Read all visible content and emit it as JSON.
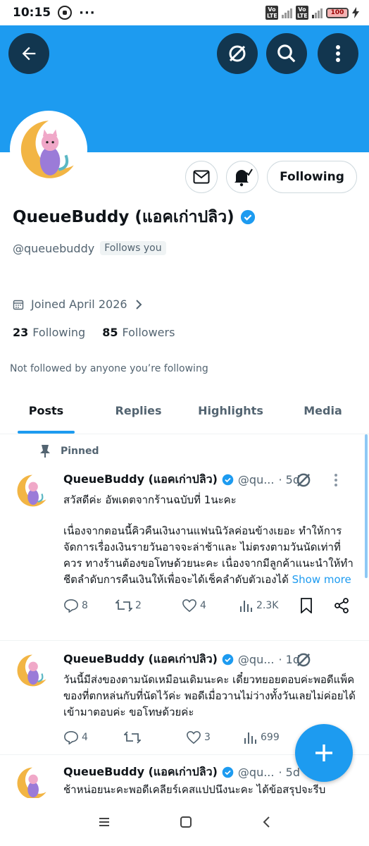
{
  "status_bar": {
    "time": "10:15",
    "more": "···",
    "volte": "Vo LTE",
    "battery": "100"
  },
  "header": {
    "back": "back",
    "grok": "grok",
    "search": "search",
    "more": "more"
  },
  "profile": {
    "name": "QueueBuddy (แอคเก่าปลิว)",
    "handle": "@queuebuddy",
    "follows_you": "Follows you",
    "joined": "Joined April 2026",
    "following_count": "23",
    "following_label": "Following",
    "followers_count": "85",
    "followers_label": "Followers",
    "not_followed": "Not followed by anyone you’re following",
    "following_button": "Following"
  },
  "tabs": [
    "Posts",
    "Replies",
    "Highlights",
    "Media"
  ],
  "pinned_label": "Pinned",
  "tweets": [
    {
      "name": "QueueBuddy (แอคเก่าปลิว)",
      "handle": "@qu...",
      "time": "· 5d",
      "line1": "สวัสดีค่ะ อัพเดตจากร้านฉบับที่ 1นะคะ",
      "line2": "เนื่องจากตอนนี้คิวคืนเงินงานแฟนนิวัลค่อนข้างเยอะ ทำให้การจัดการเรื่องเงินรายวันอาจจะล่าช้าและ ไม่ตรงตามวันนัดเท่าที่ควร ทางร้านต้องขอโทษด้วยนะคะ เนื่องจากมีลูกค้าแนะนำให้ทำชีตลำดับการคืนเงินให้เพื่อจะได้เช็คลำดับตัวเองได้",
      "show_more": "Show more",
      "replies": "8",
      "reposts": "2",
      "likes": "4",
      "views": "2.3K"
    },
    {
      "name": "QueueBuddy (แอคเก่าปลิว)",
      "handle": "@qu...",
      "time": "· 1d",
      "line1": "วันนี้มีส่งของตามนัดเหมือนเดิมนะคะ เดี๋ยวทยอยตอบค่ะพอดีแพ็คของที่ตกหล่นกับที่นัดไว้ค่ะ พอดีเมื่อวานไม่ว่างทั้งวันเลยไม่ค่อยได้เข้ามาตอบค่ะ ขอโทษด้วยค่ะ",
      "replies": "4",
      "reposts": "",
      "likes": "3",
      "views": "699"
    },
    {
      "name": "QueueBuddy (แอคเก่าปลิว)",
      "handle": "@qu...",
      "time": "· 5d",
      "line1": "ช้าหน่อยนะคะพอดีเคลียร์เคสแปปนึงนะคะ ได้ข้อสรุปจะรีบ"
    }
  ],
  "colors": {
    "accent": "#1d9bf0",
    "text": "#0f1419",
    "secondary": "#536471"
  }
}
